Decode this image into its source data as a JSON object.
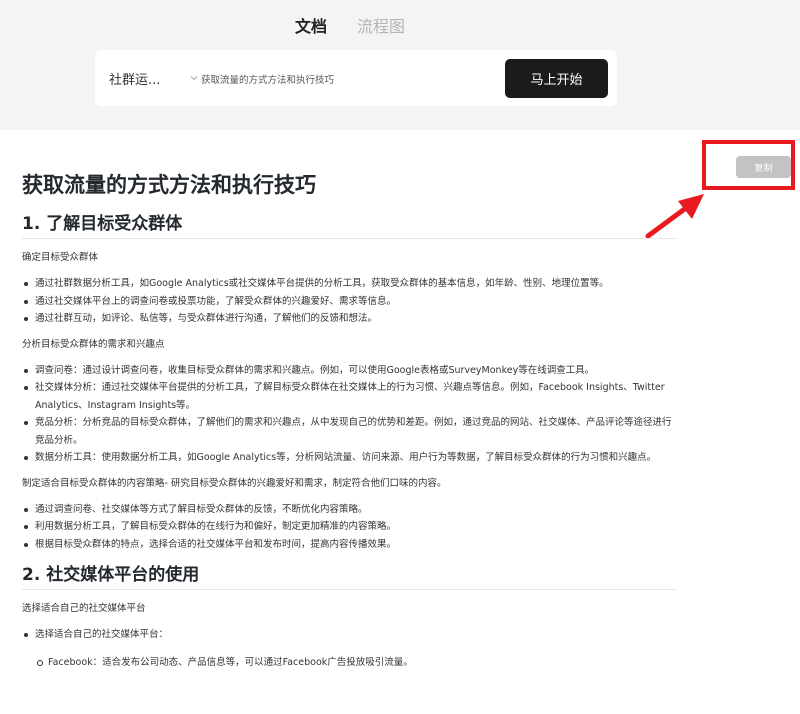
{
  "tabs": {
    "doc": "文档",
    "flow": "流程图"
  },
  "search": {
    "category": "社群运...",
    "topic": "获取流量的方式方法和执行技巧",
    "start_label": "马上开始"
  },
  "copy_label": "复制",
  "colors": {
    "highlight": "#e8191f",
    "button_dark": "#1b1b1b",
    "copy_bg": "#c3c3c3"
  },
  "doc": {
    "title": "获取流量的方式方法和执行技巧",
    "s1": {
      "heading": "1. 了解目标受众群体",
      "p1": "确定目标受众群体",
      "l1": [
        "通过社群数据分析工具，如Google Analytics或社交媒体平台提供的分析工具，获取受众群体的基本信息，如年龄、性别、地理位置等。",
        "通过社交媒体平台上的调查问卷或投票功能，了解受众群体的兴趣爱好、需求等信息。",
        "通过社群互动，如评论、私信等，与受众群体进行沟通，了解他们的反馈和想法。"
      ],
      "p2": "分析目标受众群体的需求和兴趣点",
      "l2": [
        "调查问卷：通过设计调查问卷，收集目标受众群体的需求和兴趣点。例如，可以使用Google表格或SurveyMonkey等在线调查工具。",
        "社交媒体分析：通过社交媒体平台提供的分析工具，了解目标受众群体在社交媒体上的行为习惯、兴趣点等信息。例如，Facebook Insights、Twitter Analytics、Instagram Insights等。",
        "竞品分析：分析竞品的目标受众群体，了解他们的需求和兴趣点，从中发现自己的优势和差距。例如，通过竞品的网站、社交媒体、产品评论等途径进行竞品分析。",
        "数据分析工具：使用数据分析工具，如Google Analytics等，分析网站流量、访问来源、用户行为等数据，了解目标受众群体的行为习惯和兴趣点。"
      ],
      "p3": "制定适合目标受众群体的内容策略- 研究目标受众群体的兴趣爱好和需求，制定符合他们口味的内容。",
      "l3": [
        "通过调查问卷、社交媒体等方式了解目标受众群体的反馈，不断优化内容策略。",
        "利用数据分析工具，了解目标受众群体的在线行为和偏好，制定更加精准的内容策略。",
        "根据目标受众群体的特点，选择合适的社交媒体平台和发布时间，提高内容传播效果。"
      ]
    },
    "s2": {
      "heading": "2. 社交媒体平台的使用",
      "p1": "选择适合自己的社交媒体平台",
      "l1": [
        "选择适合自己的社交媒体平台："
      ],
      "sub": [
        "Facebook：适合发布公司动态、产品信息等，可以通过Facebook广告投放吸引流量。"
      ]
    }
  }
}
